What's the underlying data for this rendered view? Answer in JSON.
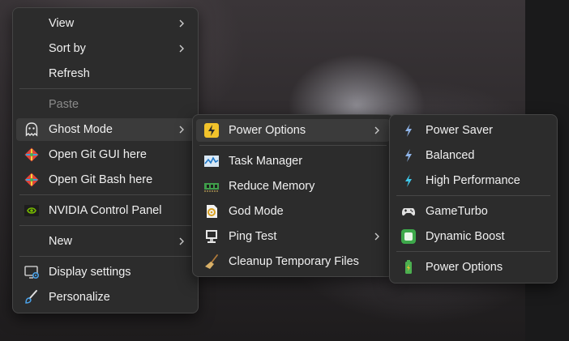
{
  "main_menu": {
    "items": [
      {
        "label": "View"
      },
      {
        "label": "Sort by"
      },
      {
        "label": "Refresh"
      },
      {
        "label": "Paste"
      },
      {
        "label": "Ghost Mode",
        "icon": "ghost-icon"
      },
      {
        "label": "Open Git GUI here",
        "icon": "git-icon"
      },
      {
        "label": "Open Git Bash here",
        "icon": "git-icon"
      },
      {
        "label": "NVIDIA Control Panel",
        "icon": "nvidia-icon"
      },
      {
        "label": "New"
      },
      {
        "label": "Display settings",
        "icon": "display-settings-icon"
      },
      {
        "label": "Personalize",
        "icon": "paintbrush-icon"
      }
    ]
  },
  "ghost_menu": {
    "items": [
      {
        "label": "Power Options",
        "icon": "lightning-tile-icon"
      },
      {
        "label": "Task Manager",
        "icon": "task-manager-icon"
      },
      {
        "label": "Reduce Memory",
        "icon": "memory-chip-icon"
      },
      {
        "label": "God Mode",
        "icon": "god-mode-icon"
      },
      {
        "label": "Ping Test",
        "icon": "computer-icon"
      },
      {
        "label": "Cleanup Temporary Files",
        "icon": "broom-icon"
      }
    ]
  },
  "power_menu": {
    "items": [
      {
        "label": "Power Saver",
        "icon": "bolt-icon"
      },
      {
        "label": "Balanced",
        "icon": "bolt-icon"
      },
      {
        "label": "High Performance",
        "icon": "bolt-icon"
      },
      {
        "label": "GameTurbo",
        "icon": "gamepad-icon"
      },
      {
        "label": "Dynamic Boost",
        "icon": "boost-icon"
      },
      {
        "label": "Power Options",
        "icon": "battery-icon"
      }
    ]
  },
  "colors": {
    "menu_bg": "#2c2c2c",
    "highlight": "#3b3b3b",
    "accent_yellow": "#f2c32b",
    "bolt_blue": "#8fb4e8",
    "bolt_cyan": "#3fc8ea",
    "nvidia_green": "#76b900"
  }
}
